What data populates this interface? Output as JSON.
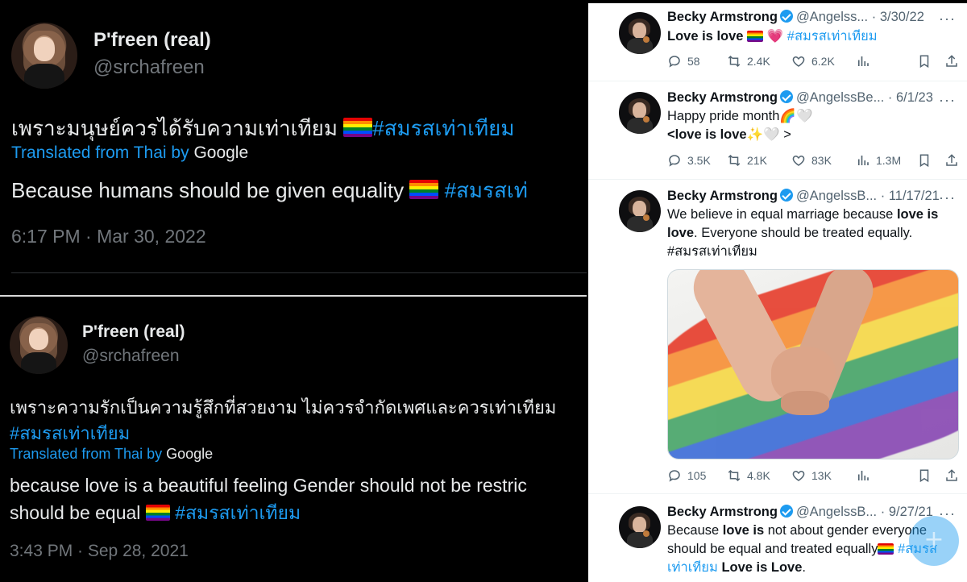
{
  "left_top": {
    "name": "P'freen (real)",
    "handle": "@srchafreen",
    "text": "เพราะมนุษย์ควรได้รับความเท่าเทียม",
    "hashtag": "#สมรสเท่าเทียม",
    "translated_label": "Translated from Thai by",
    "google": "Google",
    "translation": "Because humans should be given equality",
    "translation_hashtag": "#สมรสเท่",
    "timestamp": "6:17 PM · Mar 30, 2022"
  },
  "left_bottom": {
    "name": "P'freen (real)",
    "handle": "@srchafreen",
    "text_line1": "เพราะความรักเป็นความรู้สึกที่สวยงาม ไม่ควรจำกัดเพศและควรเท่าเทียม",
    "hashtag": "#สมรสเท่าเทียม",
    "translated_label": "Translated from Thai by",
    "google": "Google",
    "translation_line1": "because love is a beautiful feeling Gender should not be restric",
    "translation_line2": "should be equal",
    "translation_hashtag": "#สมรสเท่าเทียม",
    "timestamp": "3:43 PM · Sep 28, 2021"
  },
  "feed": [
    {
      "name": "Becky Armstrong",
      "handle": "@Angelss...",
      "date": "· 3/30/22",
      "body": [
        [
          "b",
          "Love is love "
        ],
        [
          "flag",
          ""
        ],
        [
          "t",
          " 💗 "
        ],
        [
          "h",
          "#สมรสเท่าเทียม"
        ]
      ],
      "replies": "58",
      "retweets": "2.4K",
      "likes": "6.2K",
      "views": ""
    },
    {
      "name": "Becky Armstrong",
      "handle": "@AngelssBe...",
      "date": "· 6/1/23",
      "line1": "Happy pride month🌈🤍",
      "line2_bold": "<love is love",
      "line2_rest": "✨🤍 >",
      "replies": "3.5K",
      "retweets": "21K",
      "likes": "83K",
      "views": "1.3M"
    },
    {
      "name": "Becky Armstrong",
      "handle": "@AngelssB...",
      "date": "· 11/17/21",
      "line1_pre": "We believe in equal marriage because ",
      "line1_bold": "love is",
      "line2_bold": "love",
      "line2_rest": ". Everyone should be treated equally.",
      "hashtag": "#สมรสเท่าเทียม",
      "replies": "105",
      "retweets": "4.8K",
      "likes": "13K",
      "views": ""
    },
    {
      "name": "Becky Armstrong",
      "handle": "@AngelssB...",
      "date": "· 9/27/21",
      "line1_pre": "Because ",
      "line1_bold": "love is",
      "line1_rest": " not about gender everyone",
      "line2": "should be equal and treated equally",
      "line2_hashtag": "#สมรส",
      "line3_hashtag": "เท่าเทียม",
      "line3_bold": "Love is Love",
      "line3_rest": "."
    }
  ],
  "more_label": "···",
  "icons": [
    "reply-icon",
    "retweet-icon",
    "like-icon",
    "views-icon",
    "bookmark-icon",
    "share-icon",
    "verified-icon"
  ],
  "colors": {
    "accent": "#1d9bf0",
    "dark_bg": "#000000",
    "light_bg": "#ffffff",
    "muted": "#536471"
  }
}
